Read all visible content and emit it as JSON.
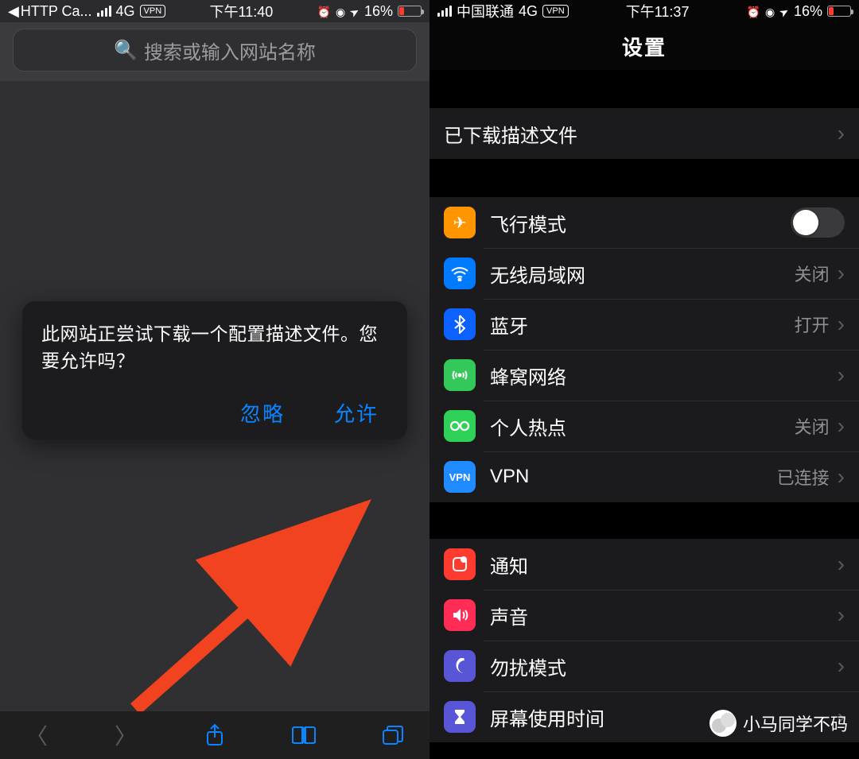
{
  "left": {
    "status": {
      "back_app": "HTTP Ca...",
      "network": "4G",
      "vpn": "VPN",
      "time": "下午11:40",
      "battery_pct": "16%"
    },
    "search_placeholder": "搜索或输入网站名称",
    "dialog": {
      "message": "此网站正尝试下载一个配置描述文件。您要允许吗？",
      "ignore": "忽略",
      "allow": "允许"
    }
  },
  "right": {
    "status": {
      "carrier": "中国联通",
      "network": "4G",
      "vpn": "VPN",
      "time": "下午11:37",
      "battery_pct": "16%"
    },
    "title": "设置",
    "downloaded_profile": "已下载描述文件",
    "rows": {
      "airplane": "飞行模式",
      "wifi": "无线局域网",
      "wifi_val": "关闭",
      "bt": "蓝牙",
      "bt_val": "打开",
      "cell": "蜂窝网络",
      "hotspot": "个人热点",
      "hotspot_val": "关闭",
      "vpn": "VPN",
      "vpn_val": "已连接",
      "notif": "通知",
      "sound": "声音",
      "dnd": "勿扰模式",
      "screen": "屏幕使用时间"
    }
  },
  "watermark": "小马同学不码"
}
